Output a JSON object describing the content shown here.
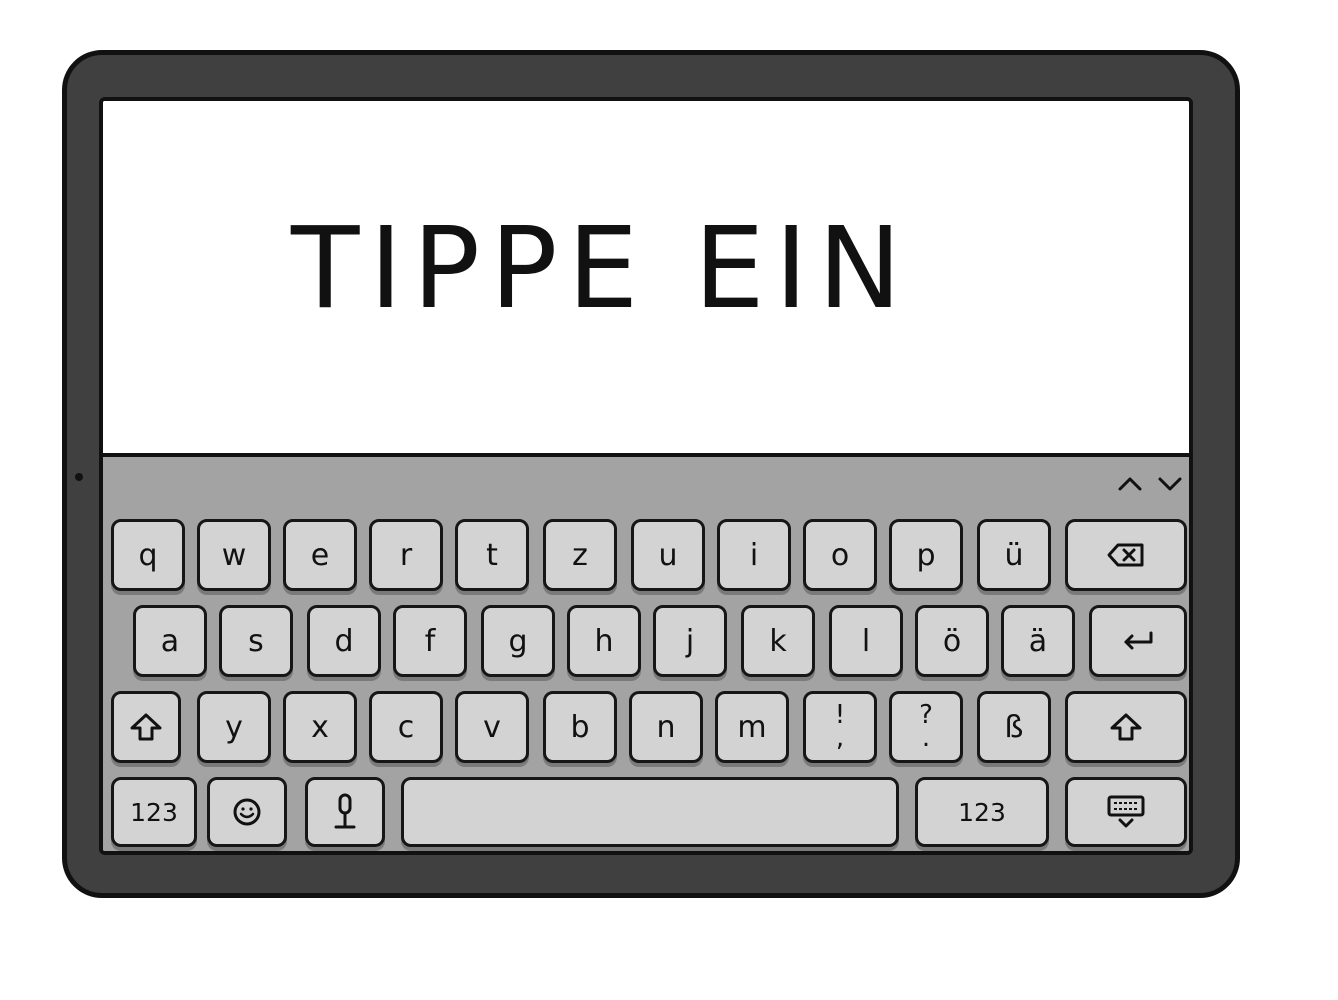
{
  "input": {
    "text": "TIPPE EIN"
  },
  "keyboard": {
    "row1": [
      "q",
      "w",
      "e",
      "r",
      "t",
      "z",
      "u",
      "i",
      "o",
      "p",
      "ü"
    ],
    "row2": [
      "a",
      "s",
      "d",
      "f",
      "g",
      "h",
      "j",
      "k",
      "l",
      "ö",
      "ä"
    ],
    "row3": [
      "y",
      "x",
      "c",
      "v",
      "b",
      "n",
      "m"
    ],
    "punct1": {
      "top": "!",
      "bottom": ","
    },
    "punct2": {
      "top": "?",
      "bottom": "."
    },
    "sz": "ß",
    "numbers_left": "123",
    "numbers_right": "123"
  },
  "icons": {
    "backspace": "backspace-icon",
    "return": "return-icon",
    "shift": "shift-icon",
    "emoji": "emoji-icon",
    "microphone": "microphone-icon",
    "hide_keyboard": "hide-keyboard-icon",
    "prev": "chevron-up-icon",
    "next": "chevron-down-icon"
  }
}
